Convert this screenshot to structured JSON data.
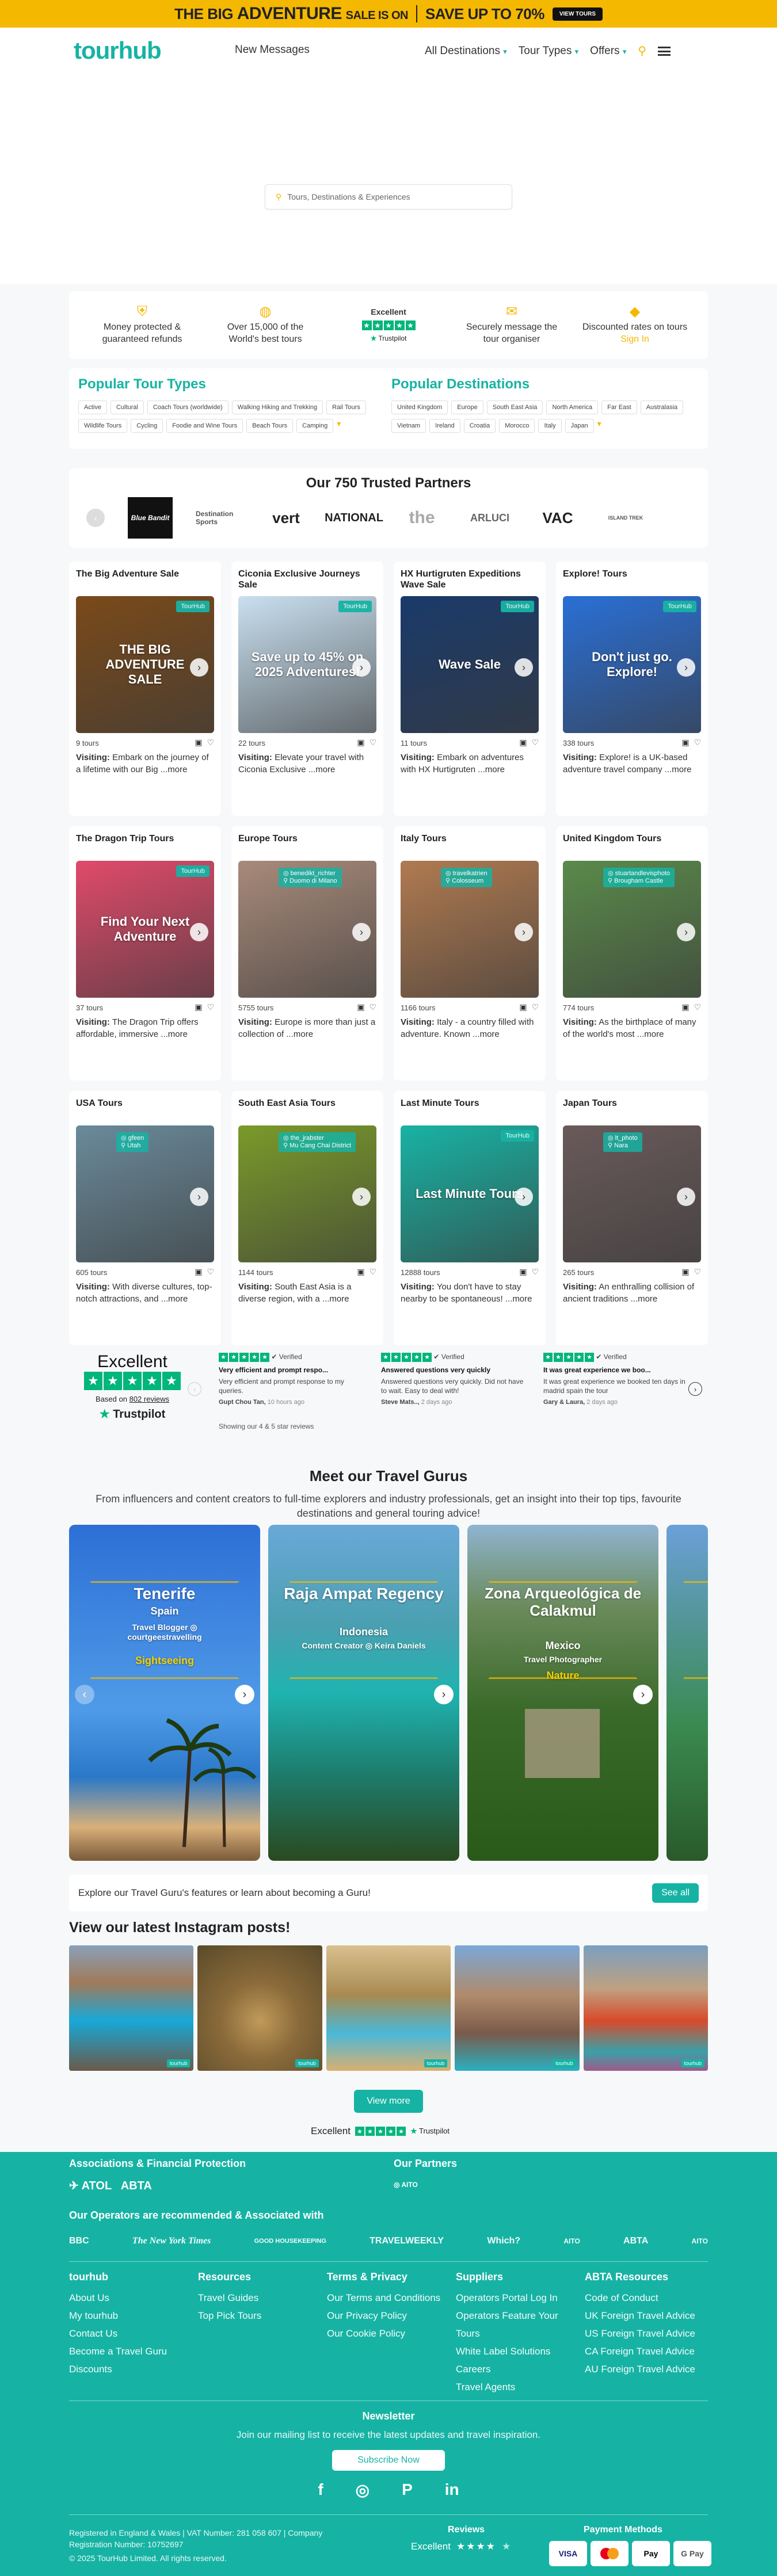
{
  "banner": {
    "text1": "THE BIG",
    "text2": "ADVENTURE",
    "text3": "SALE IS ON",
    "text4": "SAVE UP TO 70%",
    "button": "VIEW TOURS"
  },
  "header": {
    "logo": "tourhub",
    "new_messages": "New Messages",
    "nav": [
      "All Destinations",
      "Tour Types",
      "Offers"
    ]
  },
  "search": {
    "placeholder": "Tours, Destinations & Experiences"
  },
  "usp": [
    {
      "line1": "Money protected &",
      "line2": "guaranteed refunds"
    },
    {
      "line1": "Over 15,000 of the",
      "line2": "World's best tours"
    },
    {
      "title": "Excellent",
      "brand": "Trustpilot"
    },
    {
      "line1": "Securely message the",
      "line2": "tour organiser"
    },
    {
      "line1": "Discounted rates on tours",
      "line2": "Sign In"
    }
  ],
  "popular_tour_types": {
    "title": "Popular Tour Types",
    "items": [
      "Active",
      "Cultural",
      "Coach Tours (worldwide)",
      "Walking Hiking and Trekking",
      "Rail Tours",
      "Wildlife Tours",
      "Cycling",
      "Foodie and Wine Tours",
      "Beach Tours",
      "Camping"
    ]
  },
  "popular_destinations": {
    "title": "Popular Destinations",
    "items": [
      "United Kingdom",
      "Europe",
      "South East Asia",
      "North America",
      "Far East",
      "Australasia",
      "Vietnam",
      "Ireland",
      "Croatia",
      "Morocco",
      "Italy",
      "Japan"
    ]
  },
  "partners": {
    "title": "Our 750 Trusted Partners",
    "logos": [
      "Blue Bandit",
      "Destination Sports",
      "vert",
      "NATIONAL",
      "the",
      "ARLUCI",
      "VAC",
      "ISLAND TREK"
    ]
  },
  "tours": [
    {
      "title": "The Big Adventure Sale",
      "badge": "TourHub",
      "img_text": "THE BIG ADVENTURE SALE",
      "count": "9 tours",
      "desc": "Embark on the journey of a lifetime with our Big",
      "bg": "#7a4a1a"
    },
    {
      "title": "Ciconia Exclusive Journeys Sale",
      "badge": "TourHub",
      "img_text": "Save up to 45% on 2025 Adventures!",
      "count": "22 tours",
      "desc": "Elevate your travel with Ciconia Exclusive",
      "bg": "#c9e0f0"
    },
    {
      "title": "HX Hurtigruten Expeditions Wave Sale",
      "badge": "TourHub",
      "img_text": "Wave Sale",
      "count": "11 tours",
      "desc": "Embark on adventures with HX Hurtigruten",
      "bg": "#1a3a6a"
    },
    {
      "title": "Explore! Tours",
      "badge": "TourHub",
      "img_text": "Don't just go. Explore!",
      "count": "338 tours",
      "desc": "Explore! is a UK-based adventure travel company",
      "bg": "#2a6fd6"
    },
    {
      "title": "The Dragon Trip Tours",
      "badge": "TourHub",
      "img_text": "Find Your Next Adventure",
      "count": "37 tours",
      "desc": "The Dragon Trip offers affordable, immersive",
      "bg": "#e04a6a"
    },
    {
      "title": "Europe Tours",
      "loc1": "benedikt_richter",
      "loc2": "Duomo di Milano",
      "count": "5755 tours",
      "desc": "Europe is more than just a collection of",
      "bg": "#a88a7a"
    },
    {
      "title": "Italy Tours",
      "loc1": "travelkatrien",
      "loc2": "Colosseum",
      "count": "1166 tours",
      "desc": "Italy - a country filled with adventure. Known",
      "bg": "#b07a50"
    },
    {
      "title": "United Kingdom Tours",
      "loc1": "stuartandlevisphoto",
      "loc2": "Brougham Castle",
      "count": "774 tours",
      "desc": "As the birthplace of many of the world's most",
      "bg": "#5a8a4a"
    },
    {
      "title": "USA Tours",
      "loc1": "gfeen",
      "loc2": "Utah",
      "count": "605 tours",
      "desc": "With diverse cultures, top-notch attractions, and",
      "bg": "#6a8a9a"
    },
    {
      "title": "South East Asia Tours",
      "loc1": "the_jrabster",
      "loc2": "Mu Cang Chai District",
      "count": "1144 tours",
      "desc": "South East Asia is a diverse region, with a",
      "bg": "#7a9a2a"
    },
    {
      "title": "Last Minute Tours",
      "badge": "TourHub",
      "img_text": "Last Minute Tours",
      "count": "12888 tours",
      "desc": "You don't have to stay nearby to be spontaneous!",
      "bg": "#18b3a4"
    },
    {
      "title": "Japan Tours",
      "loc1": "lt_photo",
      "loc2": "Nara",
      "count": "265 tours",
      "desc": "An enthralling collision of ancient traditions",
      "bg": "#6a5a5a"
    }
  ],
  "tour_labels": {
    "visiting": "Visiting:",
    "more": "...more"
  },
  "trustpilot": {
    "excellent": "Excellent",
    "based_on": "Based on",
    "reviews": "802 reviews",
    "brand": "Trustpilot",
    "showing": "Showing our 4 & 5 star reviews",
    "verified": "Verified",
    "items": [
      {
        "title": "Very efficient and prompt respo...",
        "body": "Very efficient and prompt response to my queries.",
        "author": "Gupt Chou Tan,",
        "when": "10 hours ago"
      },
      {
        "title": "Answered questions very quickly",
        "body": "Answered questions very quickly. Did not have to wait. Easy to deal with!",
        "author": "Steve Mats..,",
        "when": "2 days ago"
      },
      {
        "title": "It was great experience we boo...",
        "body": "It was great experience we booked ten days in madrid spain the tour",
        "author": "Gary & Laura,",
        "when": "2 days ago"
      }
    ]
  },
  "gurus": {
    "title": "Meet our Travel Gurus",
    "intro": "From influencers and content creators to full-time explorers and industry professionals, get an insight into their top tips, favourite destinations and general touring advice!",
    "cards": [
      {
        "name": "Tenerife",
        "country": "Spain",
        "role": "Travel Blogger",
        "handle": "courtgeestravelling",
        "tag": "Sightseeing"
      },
      {
        "name": "Raja Ampat Regency",
        "country": "Indonesia",
        "role": "Content Creator",
        "handle": "Keira Daniels",
        "tag": ""
      },
      {
        "name": "Zona Arqueológica de Calakmul",
        "country": "Mexico",
        "role": "Travel Photographer",
        "handle": "",
        "tag": "Nature"
      }
    ],
    "bar_text": "Explore our Travel Guru's features or learn about becoming a Guru!",
    "see_all": "See all"
  },
  "instagram": {
    "title": "View our latest Instagram posts!",
    "view_more": "View more",
    "excellent": "Excellent",
    "brand": "Trustpilot"
  },
  "footer": {
    "assoc_title": "Associations & Financial Protection",
    "partners_title": "Our Partners",
    "recommended": "Our Operators are recommended & Associated with",
    "press": [
      "BBC",
      "The New York Times",
      "GOOD HOUSEKEEPING",
      "TRAVELWEEKLY",
      "Which?",
      "AITO",
      "ABTA",
      "AITO"
    ],
    "cols": [
      {
        "title": "tourhub",
        "items": [
          "About Us",
          "My tourhub",
          "Contact Us",
          "Become a Travel Guru",
          "Discounts"
        ]
      },
      {
        "title": "Resources",
        "items": [
          "Travel Guides",
          "Top Pick Tours"
        ]
      },
      {
        "title": "Terms & Privacy",
        "items": [
          "Our Terms and Conditions",
          "Our Privacy Policy",
          "Our Cookie Policy"
        ]
      },
      {
        "title": "Suppliers",
        "items": [
          "Operators Portal Log In",
          "Operators Feature Your Tours",
          "White Label Solutions",
          "Careers",
          "Travel Agents"
        ]
      },
      {
        "title": "ABTA Resources",
        "items": [
          "Code of Conduct",
          "UK Foreign Travel Advice",
          "US Foreign Travel Advice",
          "CA Foreign Travel Advice",
          "AU Foreign Travel Advice"
        ]
      }
    ],
    "newsletter_title": "Newsletter",
    "newsletter_text": "Join our mailing list to receive the latest updates and travel inspiration.",
    "subscribe": "Subscribe Now",
    "legal1": "Registered in England & Wales | VAT Number: 281 058 607 | Company",
    "legal2": "Registration Number: 10752697",
    "legal3": "© 2025 TourHub Limited. All rights reserved.",
    "reviews": "Reviews",
    "excellent": "Excellent",
    "payment": "Payment Methods",
    "pay": [
      "VISA",
      "MC",
      "Pay",
      "G Pay"
    ]
  },
  "colors": {
    "teal": "#16b3a4",
    "yellow": "#f5b800",
    "trustpilot": "#00b67a"
  }
}
